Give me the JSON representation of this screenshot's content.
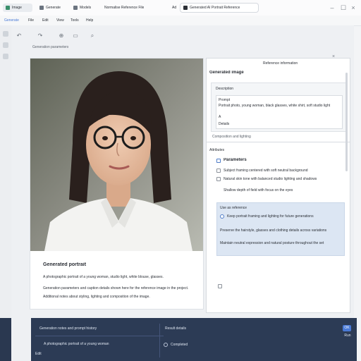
{
  "window": {
    "tabs": [
      {
        "label": "Image"
      },
      {
        "label": "Generate"
      },
      {
        "label": "Models"
      },
      {
        "label": "Normalise Reference File"
      },
      {
        "label": "Add"
      }
    ],
    "title_tab": "Generated AI Portrait Reference",
    "actions": [
      "minimize",
      "maximize",
      "close"
    ]
  },
  "toolbar2": {
    "path": "Generate",
    "items": [
      "File",
      "Edit",
      "View",
      "Tools",
      "Help"
    ]
  },
  "breadcrumb": {
    "text": "Generation parameters"
  },
  "photo_caption": {
    "heading": "Generated portrait",
    "line1": "A photographic portrait of a young woman, studio light, white blouse, glasses.",
    "line2": "Generation parameters and caption details shown here for the reference image in the project.",
    "line3": "Additional notes about styling, lighting and composition of the image."
  },
  "right_panel": {
    "header": "Reference information",
    "title": "Generated image",
    "section1": {
      "label": "Description",
      "field_label": "Prompt",
      "prompt_line": "Portrait photo, young woman, black glasses, white shirt, soft studio light",
      "value_a": "A",
      "value_b": "Details"
    },
    "divider": "Composition and lighting",
    "section2_title": "Attributes",
    "checkbox_title": "Parameters",
    "items": [
      "Subject framing centered with soft neutral background",
      "Natural skin tone with balanced studio lighting and shadows",
      "Shallow depth of field with focus on the eyes"
    ],
    "callout_title": "Use as reference",
    "radio_label": "Keep portrait framing and lighting for future generations",
    "callout_lines": [
      "Preserve the hairstyle, glasses and clothing details across variations",
      "Maintain neutral expression and natural posture throughout the set"
    ]
  },
  "bottom": {
    "left_title": "Generation notes and prompt history",
    "left_row": "A photographic portrait of a young woman",
    "left_more": "Edit",
    "right_title": "Result details",
    "right_row": "Completed",
    "button": "OK",
    "small_button": "Run"
  },
  "colors": {
    "accent": "#4a7ad6",
    "dark_bar": "#2c3b55",
    "highlight": "#dce6f3"
  },
  "icons": [
    "app-icon",
    "search-icon",
    "settings-icon",
    "image-icon",
    "folder-icon",
    "undo-icon",
    "redo-icon",
    "zoom-icon"
  ]
}
